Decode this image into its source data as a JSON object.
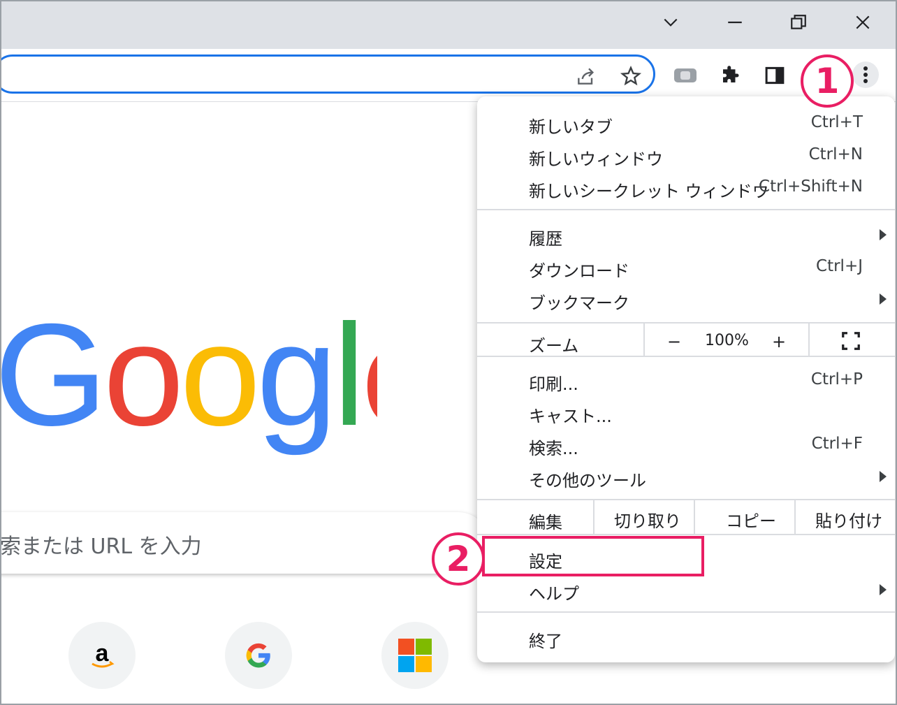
{
  "window_controls": {
    "tab_search_icon": "chevron-down",
    "minimize_icon": "minus",
    "restore_icon": "restore",
    "close_icon": "x"
  },
  "toolbar": {
    "share_icon": "share",
    "bookmark_icon": "star",
    "extension_icon": "puzzle",
    "sidepanel_icon": "side-panel",
    "menu_icon": "vertical-dots"
  },
  "page": {
    "logo": {
      "letters": [
        "G",
        "o",
        "o",
        "g",
        "l",
        "e"
      ],
      "colors": [
        "#4285f4",
        "#ea4335",
        "#fbbc05",
        "#4285f4",
        "#34a853",
        "#ea4335"
      ]
    },
    "search_placeholder": "検索またはURLを入力",
    "search_visible_text": "索または URL を入力",
    "shortcuts": [
      "amazon",
      "google",
      "microsoft"
    ]
  },
  "menu": {
    "items": [
      {
        "label": "新しいタブ",
        "shortcut": "Ctrl+T"
      },
      {
        "label": "新しいウィンドウ",
        "shortcut": "Ctrl+N"
      },
      {
        "label": "新しいシークレット ウィンドウ",
        "shortcut": "Ctrl+Shift+N"
      },
      {
        "label": "履歴",
        "shortcut": ""
      },
      {
        "label": "ダウンロード",
        "shortcut": "Ctrl+J"
      },
      {
        "label": "ブックマーク",
        "shortcut": ""
      },
      {
        "label": "印刷...",
        "shortcut": "Ctrl+P"
      },
      {
        "label": "キャスト...",
        "shortcut": ""
      },
      {
        "label": "検索...",
        "shortcut": "Ctrl+F"
      },
      {
        "label": "その他のツール",
        "shortcut": ""
      },
      {
        "label": "設定",
        "shortcut": ""
      },
      {
        "label": "ヘルプ",
        "shortcut": ""
      },
      {
        "label": "終了",
        "shortcut": ""
      }
    ],
    "zoom": {
      "label": "ズーム",
      "minus": "−",
      "value": "100%",
      "plus": "+"
    },
    "edit": {
      "label": "編集",
      "cut": "切り取り",
      "copy": "コピー",
      "paste": "貼り付け"
    }
  },
  "annotations": {
    "step1": "1",
    "step2": "2",
    "color": "#e91e63"
  },
  "colors": {
    "accent": "#1a73e8",
    "titlebar": "#dee1e6"
  }
}
